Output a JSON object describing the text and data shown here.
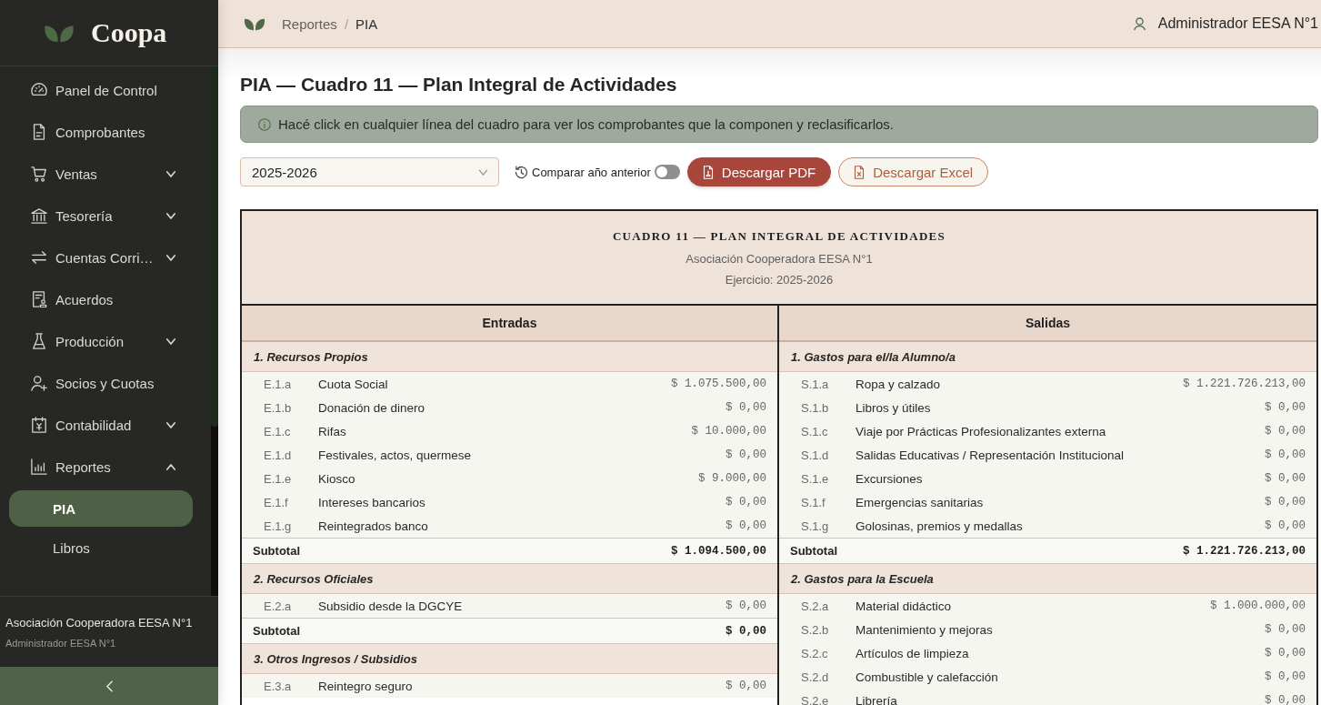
{
  "sidebar": {
    "brand": "Coopa",
    "nav": [
      {
        "label": "Panel de Control",
        "kind": "link"
      },
      {
        "label": "Comprobantes",
        "kind": "link"
      },
      {
        "label": "Ventas",
        "kind": "group",
        "expanded": false
      },
      {
        "label": "Tesorería",
        "kind": "group",
        "expanded": false
      },
      {
        "label": "Cuentas Corri…",
        "kind": "group",
        "expanded": false
      },
      {
        "label": "Acuerdos",
        "kind": "link"
      },
      {
        "label": "Producción",
        "kind": "group",
        "expanded": false
      },
      {
        "label": "Socios y Cuotas",
        "kind": "link"
      },
      {
        "label": "Contabilidad",
        "kind": "group",
        "expanded": false
      },
      {
        "label": "Reportes",
        "kind": "group",
        "expanded": true,
        "children": [
          {
            "label": "PIA",
            "selected": true
          },
          {
            "label": "Libros",
            "selected": false
          }
        ]
      }
    ],
    "footer": {
      "organization": "Asociación Cooperadora EESA N°1",
      "user": "Administrador EESA N°1"
    }
  },
  "header": {
    "breadcrumb": [
      "Reportes",
      "PIA"
    ],
    "separator": "/",
    "user": "Administrador EESA N°1"
  },
  "page": {
    "title": "PIA — Cuadro 11 — Plan Integral de Actividades",
    "info": "Hacé click en cualquier línea del cuadro para ver los comprobantes que la componen y reclasificarlos.",
    "year_select": {
      "value": "2025-2026"
    },
    "compare": {
      "label": "Comparar año anterior",
      "on": false
    },
    "buttons": [
      {
        "label": "Descargar PDF",
        "kind": "primary"
      },
      {
        "label": "Descargar Excel",
        "kind": "outline"
      }
    ]
  },
  "report": {
    "title": "CUADRO 11 — PLAN INTEGRAL DE ACTIVIDADES",
    "organization": "Asociación Cooperadora EESA N°1",
    "period": "Ejercicio: 2025-2026",
    "columns": [
      {
        "heading": "Entradas",
        "sections": [
          {
            "title": "1. Recursos Propios",
            "rows": [
              {
                "code": "E.1.a",
                "name": "Cuota Social",
                "amount": "$ 1.075.500,00"
              },
              {
                "code": "E.1.b",
                "name": "Donación de dinero",
                "amount": "$ 0,00"
              },
              {
                "code": "E.1.c",
                "name": "Rifas",
                "amount": "$ 10.000,00"
              },
              {
                "code": "E.1.d",
                "name": "Festivales, actos, quermese",
                "amount": "$ 0,00"
              },
              {
                "code": "E.1.e",
                "name": "Kiosco",
                "amount": "$ 9.000,00"
              },
              {
                "code": "E.1.f",
                "name": "Intereses bancarios",
                "amount": "$ 0,00"
              },
              {
                "code": "E.1.g",
                "name": "Reintegrados banco",
                "amount": "$ 0,00"
              }
            ],
            "subtotal": {
              "label": "Subtotal",
              "amount": "$ 1.094.500,00"
            }
          },
          {
            "title": "2. Recursos Oficiales",
            "rows": [
              {
                "code": "E.2.a",
                "name": "Subsidio desde la DGCYE",
                "amount": "$ 0,00"
              }
            ],
            "subtotal": {
              "label": "Subtotal",
              "amount": "$ 0,00"
            }
          },
          {
            "title": "3. Otros Ingresos / Subsidios",
            "rows": [
              {
                "code": "E.3.a",
                "name": "Reintegro seguro",
                "amount": "$ 0,00"
              }
            ]
          }
        ]
      },
      {
        "heading": "Salidas",
        "sections": [
          {
            "title": "1. Gastos para el/la Alumno/a",
            "rows": [
              {
                "code": "S.1.a",
                "name": "Ropa y calzado",
                "amount": "$ 1.221.726.213,00"
              },
              {
                "code": "S.1.b",
                "name": "Libros y útiles",
                "amount": "$ 0,00"
              },
              {
                "code": "S.1.c",
                "name": "Viaje por Prácticas Profesionalizantes externa",
                "amount": "$ 0,00"
              },
              {
                "code": "S.1.d",
                "name": "Salidas Educativas / Representación Institucional",
                "amount": "$ 0,00"
              },
              {
                "code": "S.1.e",
                "name": "Excursiones",
                "amount": "$ 0,00"
              },
              {
                "code": "S.1.f",
                "name": "Emergencias sanitarias",
                "amount": "$ 0,00"
              },
              {
                "code": "S.1.g",
                "name": "Golosinas, premios y medallas",
                "amount": "$ 0,00"
              }
            ],
            "subtotal": {
              "label": "Subtotal",
              "amount": "$ 1.221.726.213,00"
            }
          },
          {
            "title": "2. Gastos para la Escuela",
            "rows": [
              {
                "code": "S.2.a",
                "name": "Material didáctico",
                "amount": "$ 1.000.000,00"
              },
              {
                "code": "S.2.b",
                "name": "Mantenimiento y mejoras",
                "amount": "$ 0,00"
              },
              {
                "code": "S.2.c",
                "name": "Artículos de limpieza",
                "amount": "$ 0,00"
              },
              {
                "code": "S.2.d",
                "name": "Combustible y calefacción",
                "amount": "$ 0,00"
              },
              {
                "code": "S.2.e",
                "name": "Librería",
                "amount": "$ 0,00"
              }
            ]
          }
        ]
      }
    ]
  }
}
